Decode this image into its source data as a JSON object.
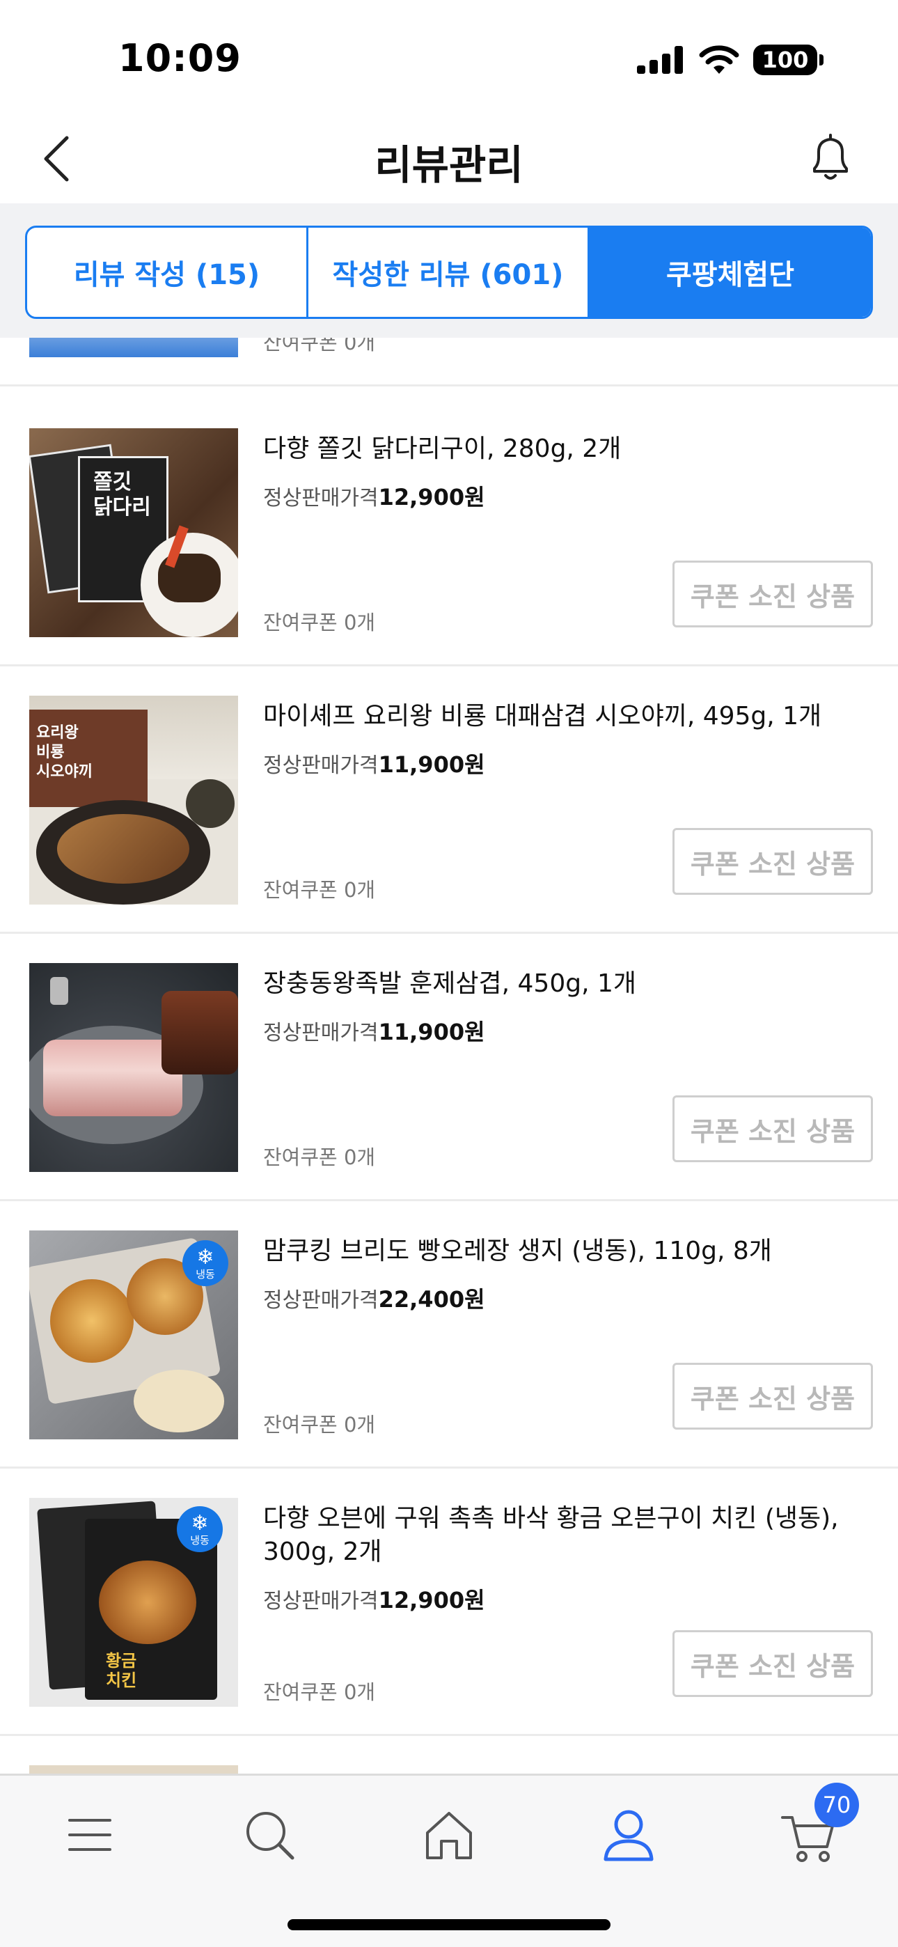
{
  "status_bar": {
    "time": "10:09",
    "battery": "100"
  },
  "header": {
    "title": "리뷰관리"
  },
  "tabs": [
    {
      "label": "리뷰 작성 (15)",
      "active": false
    },
    {
      "label": "작성한 리뷰 (601)",
      "active": false
    },
    {
      "label": "쿠팡체험단",
      "active": true
    }
  ],
  "partial_item": {
    "coupon": "잔여쿠폰 0개"
  },
  "items": [
    {
      "name": "다향 쫄깃 닭다리구이, 280g, 2개",
      "price_label": "정상판매가격",
      "price": "12,900원",
      "coupon": "잔여쿠폰 0개",
      "button": "쿠폰 소진 상품",
      "frozen": false
    },
    {
      "name": "마이셰프 요리왕 비룡 대패삼겹 시오야끼, 495g, 1개",
      "price_label": "정상판매가격",
      "price": "11,900원",
      "coupon": "잔여쿠폰 0개",
      "button": "쿠폰 소진 상품",
      "frozen": false
    },
    {
      "name": "장충동왕족발 훈제삼겹, 450g, 1개",
      "price_label": "정상판매가격",
      "price": "11,900원",
      "coupon": "잔여쿠폰 0개",
      "button": "쿠폰 소진 상품",
      "frozen": false
    },
    {
      "name": "맘쿠킹 브리도 빵오레장 생지 (냉동), 110g, 8개",
      "price_label": "정상판매가격",
      "price": "22,400원",
      "coupon": "잔여쿠폰 0개",
      "button": "쿠폰 소진 상품",
      "frozen": true
    },
    {
      "name": "다향 오븐에 구워 촉촉 바삭 황금 오븐구이 치킨 (냉동), 300g, 2개",
      "price_label": "정상판매가격",
      "price": "12,900원",
      "coupon": "잔여쿠폰 0개",
      "button": "쿠폰 소진 상품",
      "frozen": true
    }
  ],
  "thumbnail_text": {
    "item0": [
      "쫄깃",
      "닭다리"
    ],
    "item1": [
      "요리왕",
      "비룡",
      "시오야끼"
    ],
    "item4": [
      "황금",
      "치킨"
    ]
  },
  "frozen_badge": "냉동",
  "bottom_nav": {
    "items": [
      "menu-icon",
      "search-icon",
      "home-icon",
      "user-icon",
      "cart-icon"
    ],
    "active": "user-icon",
    "cart_count": "70"
  },
  "colors": {
    "accent": "#1a7df1",
    "badge": "#2c6bf2",
    "frozen": "#1677e5"
  }
}
